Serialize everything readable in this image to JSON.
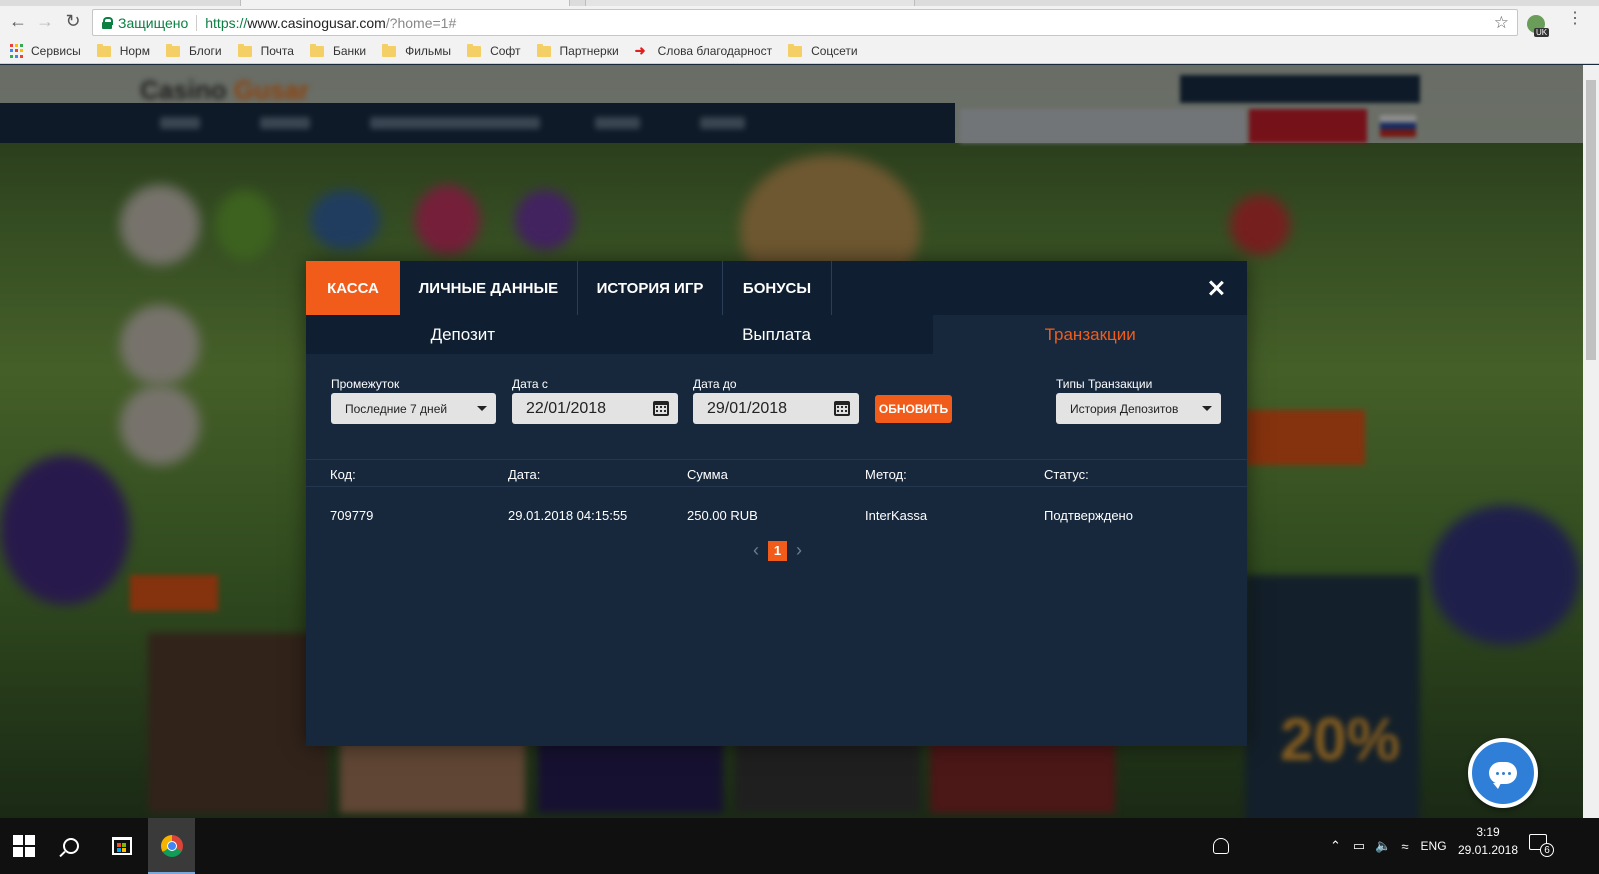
{
  "browser": {
    "secure_label": "Защищено",
    "url_scheme": "https://",
    "url_host": "www.casinogusar.com",
    "url_rest": "/?home=1#",
    "ext_badge": "UK"
  },
  "bookmarks": [
    {
      "label": "Сервисы",
      "icon": "apps-icon"
    },
    {
      "label": "Норм",
      "icon": "folder-icon"
    },
    {
      "label": "Блоги",
      "icon": "folder-icon"
    },
    {
      "label": "Почта",
      "icon": "folder-icon"
    },
    {
      "label": "Банки",
      "icon": "folder-icon"
    },
    {
      "label": "Фильмы",
      "icon": "folder-icon"
    },
    {
      "label": "Софт",
      "icon": "folder-icon"
    },
    {
      "label": "Партнерки",
      "icon": "folder-icon"
    },
    {
      "label": "Слова благодарност",
      "icon": "arrow-icon"
    },
    {
      "label": "Соцсети",
      "icon": "folder-icon"
    }
  ],
  "site": {
    "logo_main": "Casino",
    "logo_accent": "Gusar",
    "percent": "20%"
  },
  "modal": {
    "tabs": [
      {
        "label": "КАССА",
        "active": true
      },
      {
        "label": "ЛИЧНЫЕ ДАННЫЕ",
        "active": false
      },
      {
        "label": "ИСТОРИЯ ИГР",
        "active": false
      },
      {
        "label": "БОНУСЫ",
        "active": false
      }
    ],
    "subtabs": [
      {
        "label": "Депозит",
        "active": false
      },
      {
        "label": "Выплата",
        "active": false
      },
      {
        "label": "Транзакции",
        "active": true
      }
    ],
    "filters": {
      "period_label": "Промежуток",
      "period_value": "Последние 7 дней",
      "date_from_label": "Дата с",
      "date_from_value": "22/01/2018",
      "date_to_label": "Дата до",
      "date_to_value": "29/01/2018",
      "refresh_label": "ОБНОВИТЬ",
      "type_label": "Типы Транзакции",
      "type_value": "История Депозитов"
    },
    "table": {
      "headers": [
        "Код:",
        "Дата:",
        "Сумма",
        "Метод:",
        "Статус:"
      ],
      "rows": [
        [
          "709779",
          "29.01.2018 04:15:55",
          "250.00 RUB",
          "InterKassa",
          "Подтверждено"
        ]
      ]
    },
    "pagination": {
      "current": "1"
    }
  },
  "taskbar": {
    "lang": "ENG",
    "time": "3:19",
    "date": "29.01.2018",
    "notifications": "6"
  },
  "colors": {
    "accent": "#f25c1a",
    "modal_bg": "#17283d",
    "tab_bar": "#0f1e30"
  }
}
